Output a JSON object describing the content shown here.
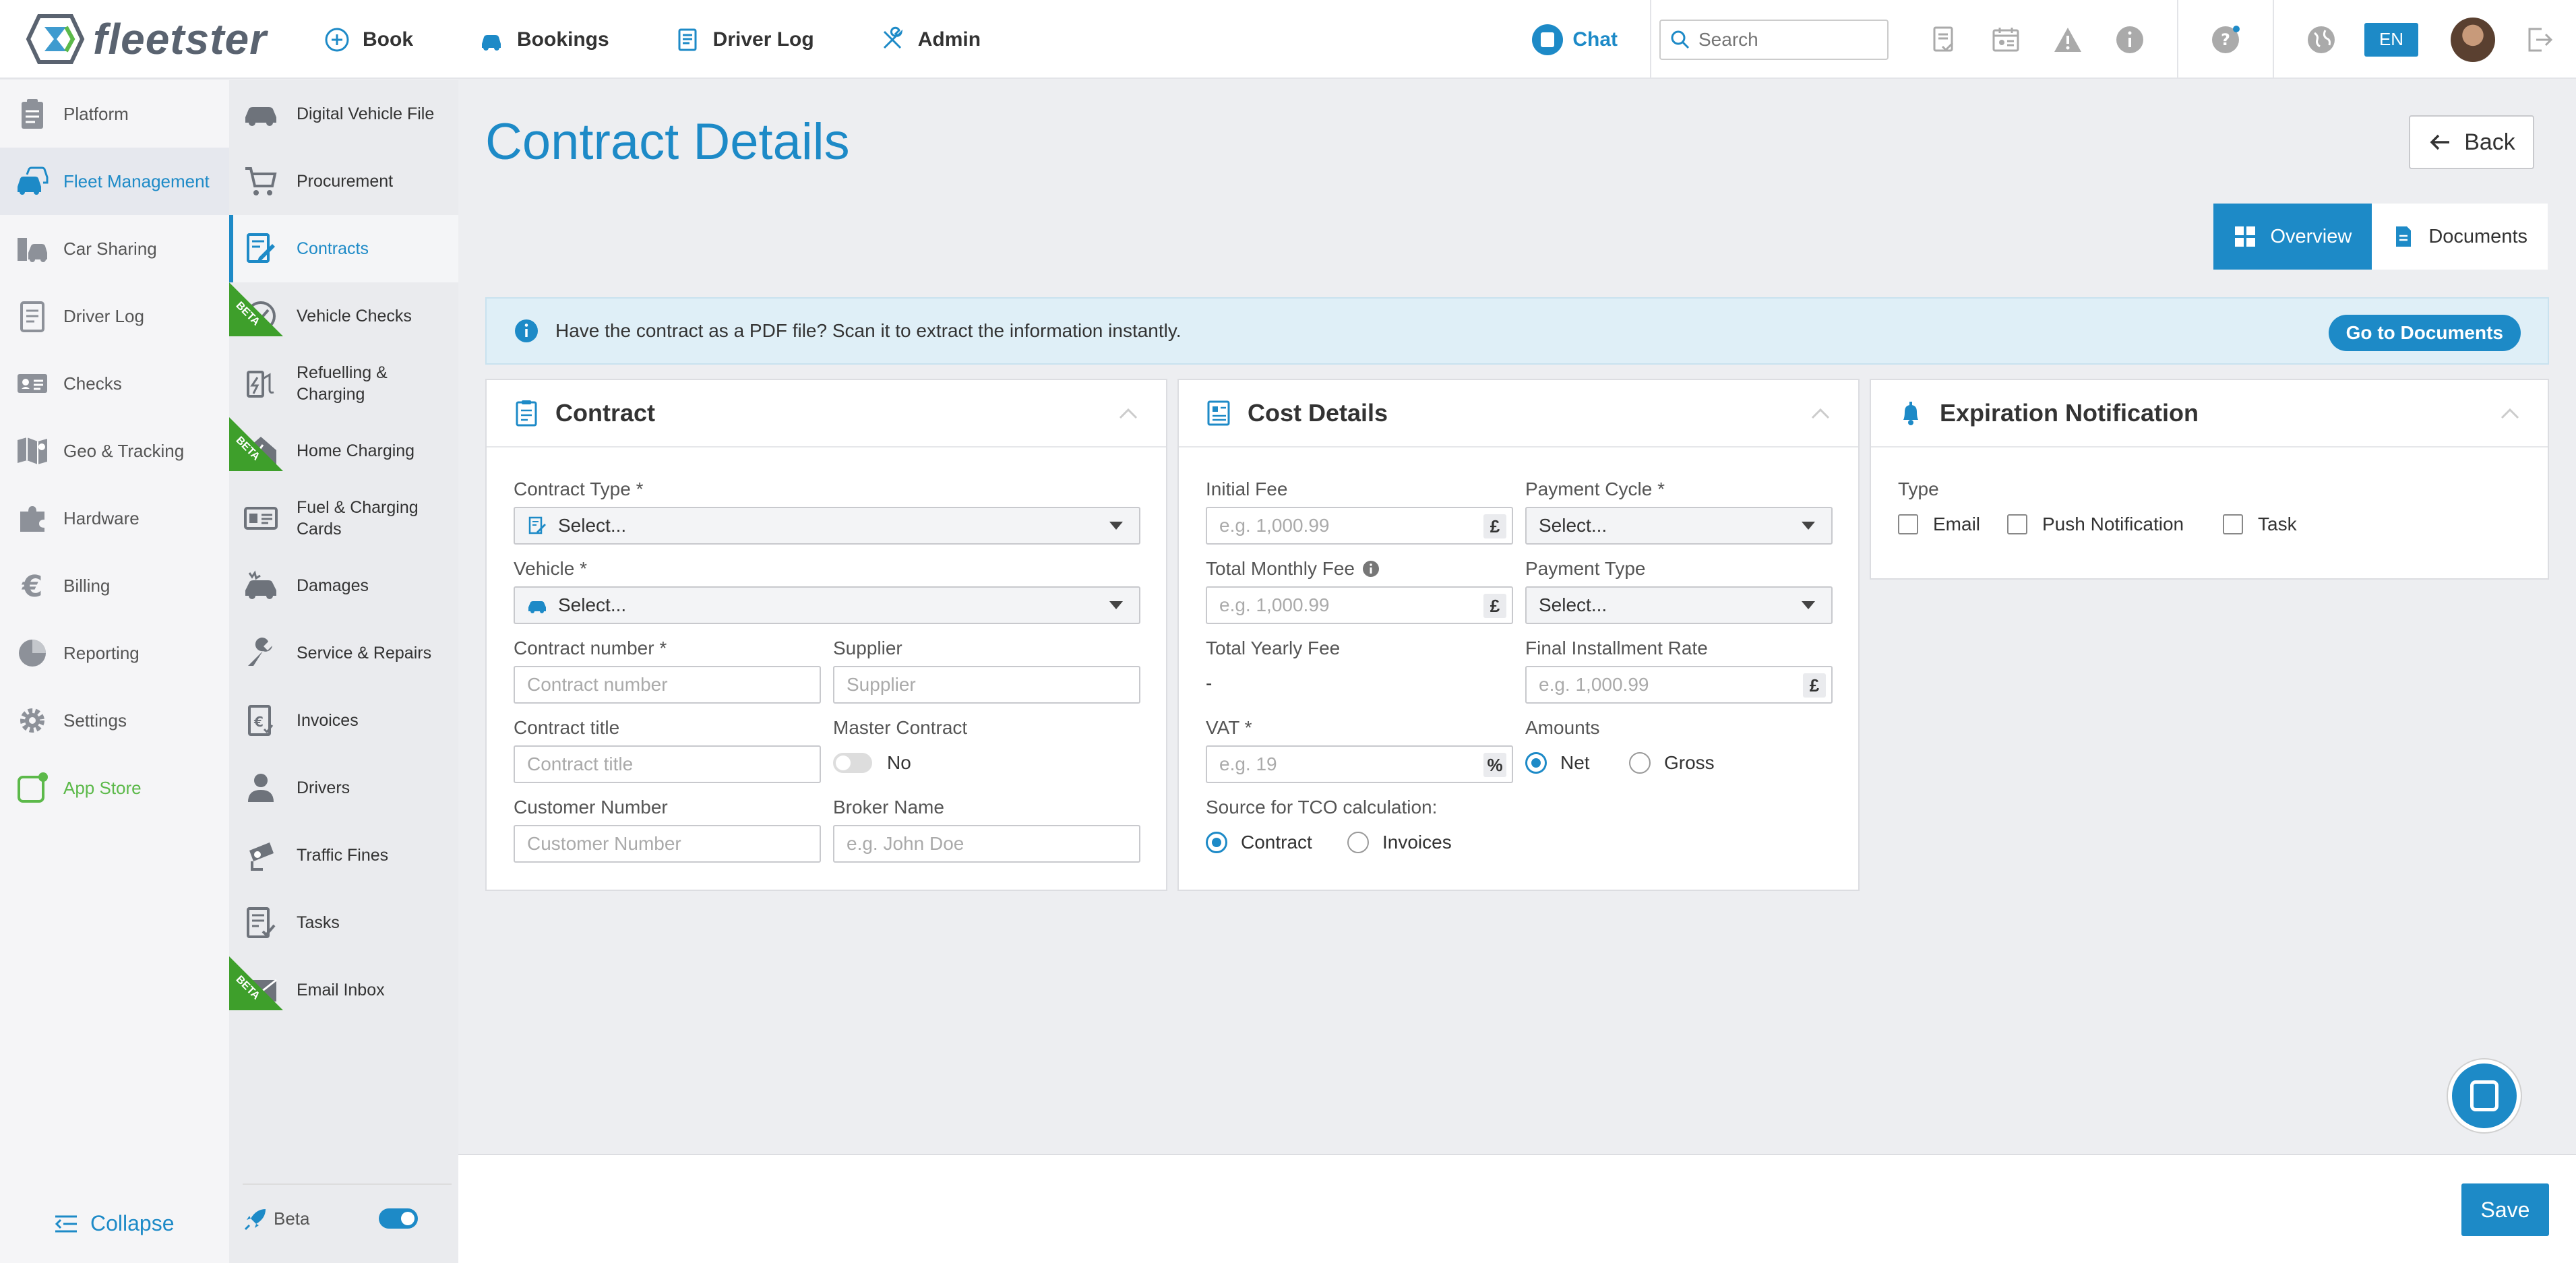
{
  "app": {
    "logo_text": "fleetster",
    "brand_color": "#1d8ac7"
  },
  "topnav": {
    "items": [
      {
        "label": "Book",
        "icon": "plus-circle-icon"
      },
      {
        "label": "Bookings",
        "icon": "car-icon"
      },
      {
        "label": "Driver Log",
        "icon": "logbook-icon"
      },
      {
        "label": "Admin",
        "icon": "tools-icon"
      }
    ],
    "chat_label": "Chat",
    "search_placeholder": "Search",
    "lang": "EN"
  },
  "sidebar_primary": {
    "items": [
      {
        "label": "Platform"
      },
      {
        "label": "Fleet Management"
      },
      {
        "label": "Car Sharing"
      },
      {
        "label": "Driver Log"
      },
      {
        "label": "Checks"
      },
      {
        "label": "Geo & Tracking"
      },
      {
        "label": "Hardware"
      },
      {
        "label": "Billing"
      },
      {
        "label": "Reporting"
      },
      {
        "label": "Settings"
      },
      {
        "label": "App Store"
      }
    ],
    "collapse_label": "Collapse"
  },
  "sidebar_secondary": {
    "items": [
      {
        "label": "Digital Vehicle File"
      },
      {
        "label": "Procurement"
      },
      {
        "label": "Contracts"
      },
      {
        "label": "Vehicle Checks",
        "beta": "BETA"
      },
      {
        "label": "Refuelling & Charging"
      },
      {
        "label": "Home Charging",
        "beta": "BETA"
      },
      {
        "label": "Fuel & Charging Cards"
      },
      {
        "label": "Damages"
      },
      {
        "label": "Service & Repairs"
      },
      {
        "label": "Invoices"
      },
      {
        "label": "Drivers"
      },
      {
        "label": "Traffic Fines"
      },
      {
        "label": "Tasks"
      },
      {
        "label": "Email Inbox",
        "beta": "BETA"
      }
    ],
    "beta_label": "Beta"
  },
  "page": {
    "title": "Contract Details",
    "back_label": "Back",
    "tabs": [
      {
        "label": "Overview"
      },
      {
        "label": "Documents"
      }
    ],
    "banner_text": "Have the contract as a PDF file? Scan it to extract the information instantly.",
    "banner_button": "Go to Documents",
    "save_label": "Save"
  },
  "contract_card": {
    "title": "Contract",
    "contract_type_label": "Contract Type *",
    "contract_type_value": "Select...",
    "vehicle_label": "Vehicle *",
    "vehicle_value": "Select...",
    "contract_number_label": "Contract number *",
    "contract_number_placeholder": "Contract number",
    "supplier_label": "Supplier",
    "supplier_placeholder": "Supplier",
    "contract_title_label": "Contract title",
    "contract_title_placeholder": "Contract title",
    "master_contract_label": "Master Contract",
    "master_contract_value": "No",
    "customer_number_label": "Customer Number",
    "customer_number_placeholder": "Customer Number",
    "broker_name_label": "Broker Name",
    "broker_name_placeholder": "e.g. John Doe"
  },
  "cost_card": {
    "title": "Cost Details",
    "initial_fee_label": "Initial Fee",
    "initial_fee_placeholder": "e.g. 1,000.99",
    "currency": "£",
    "payment_cycle_label": "Payment Cycle *",
    "payment_cycle_value": "Select...",
    "total_monthly_fee_label": "Total Monthly Fee",
    "total_monthly_fee_placeholder": "e.g. 1,000.99",
    "payment_type_label": "Payment Type",
    "payment_type_value": "Select...",
    "total_yearly_fee_label": "Total Yearly Fee",
    "total_yearly_fee_value": "-",
    "final_installment_label": "Final Installment Rate",
    "final_installment_placeholder": "e.g. 1,000.99",
    "vat_label": "VAT *",
    "vat_placeholder": "e.g. 19",
    "vat_unit": "%",
    "amounts_label": "Amounts",
    "amounts_options": [
      "Net",
      "Gross"
    ],
    "tco_label": "Source for TCO calculation:",
    "tco_options": [
      "Contract",
      "Invoices"
    ]
  },
  "expiration_card": {
    "title": "Expiration Notification",
    "type_label": "Type",
    "type_options": [
      "Email",
      "Push Notification",
      "Task"
    ]
  }
}
